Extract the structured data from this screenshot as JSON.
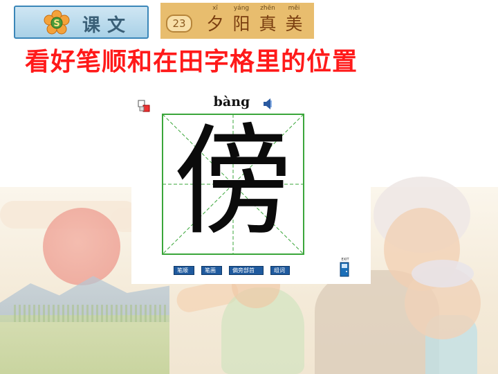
{
  "header": {
    "kewen_label": "课文",
    "lesson_number": "23",
    "lesson_title": [
      {
        "pinyin": "xī",
        "hanzi": "夕"
      },
      {
        "pinyin": "yáng",
        "hanzi": "阳"
      },
      {
        "pinyin": "zhēn",
        "hanzi": "真"
      },
      {
        "pinyin": "měi",
        "hanzi": "美"
      }
    ]
  },
  "headline": "看好笔顺和在田字格里的位置",
  "panel": {
    "pinyin": "bàng",
    "character": "傍",
    "buttons": [
      "笔顺",
      "笔画",
      "偏旁部首",
      "组词"
    ],
    "exit_label": "EXIT"
  },
  "colors": {
    "headline": "#ff1a1a",
    "grid_border": "#3aa63a",
    "button_bg": "#1f5a9e",
    "banner": "#e8bd6e"
  }
}
